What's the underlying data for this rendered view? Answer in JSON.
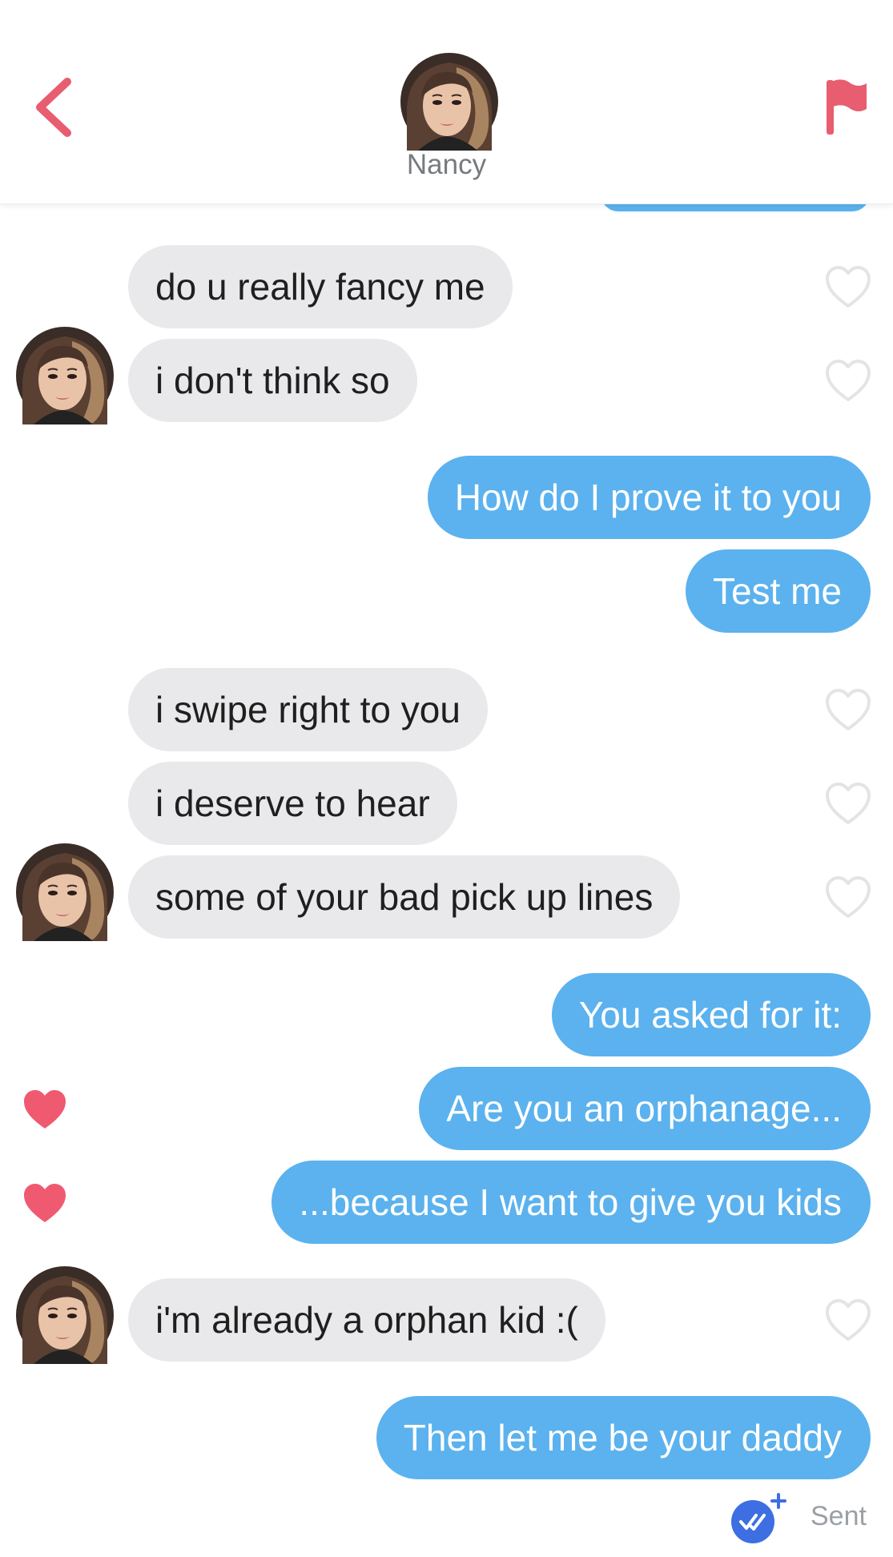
{
  "header": {
    "contact_name": "Nancy",
    "accent_color": "#e85d6f",
    "back_icon": "chevron-left-icon",
    "flag_icon": "flag-icon"
  },
  "colors": {
    "outgoing_bubble": "#5bb2ee",
    "incoming_bubble": "#e9e9eb",
    "heart_liked": "#ef5a71",
    "heart_outline": "#e4e4e4"
  },
  "messages": [
    {
      "text": "do u really fancy me",
      "direction": "incoming",
      "liked": false
    },
    {
      "text": "i don't think so",
      "direction": "incoming",
      "liked": false
    },
    {
      "text": "How do I prove it to you",
      "direction": "outgoing",
      "liked": false
    },
    {
      "text": "Test me",
      "direction": "outgoing",
      "liked": false
    },
    {
      "text": "i swipe right to you",
      "direction": "incoming",
      "liked": false
    },
    {
      "text": "i deserve to hear",
      "direction": "incoming",
      "liked": false
    },
    {
      "text": "some of your bad pick up lines",
      "direction": "incoming",
      "liked": false
    },
    {
      "text": "You asked for it:",
      "direction": "outgoing",
      "liked": false
    },
    {
      "text": "Are you an orphanage...",
      "direction": "outgoing",
      "liked": true
    },
    {
      "text": "...because I want to give you kids",
      "direction": "outgoing",
      "liked": true
    },
    {
      "text": "i'm already a orphan kid :(",
      "direction": "incoming",
      "liked": false
    },
    {
      "text": "Then let me be your daddy",
      "direction": "outgoing",
      "liked": false
    }
  ],
  "status": {
    "label": "Sent",
    "icon": "double-check-icon"
  }
}
